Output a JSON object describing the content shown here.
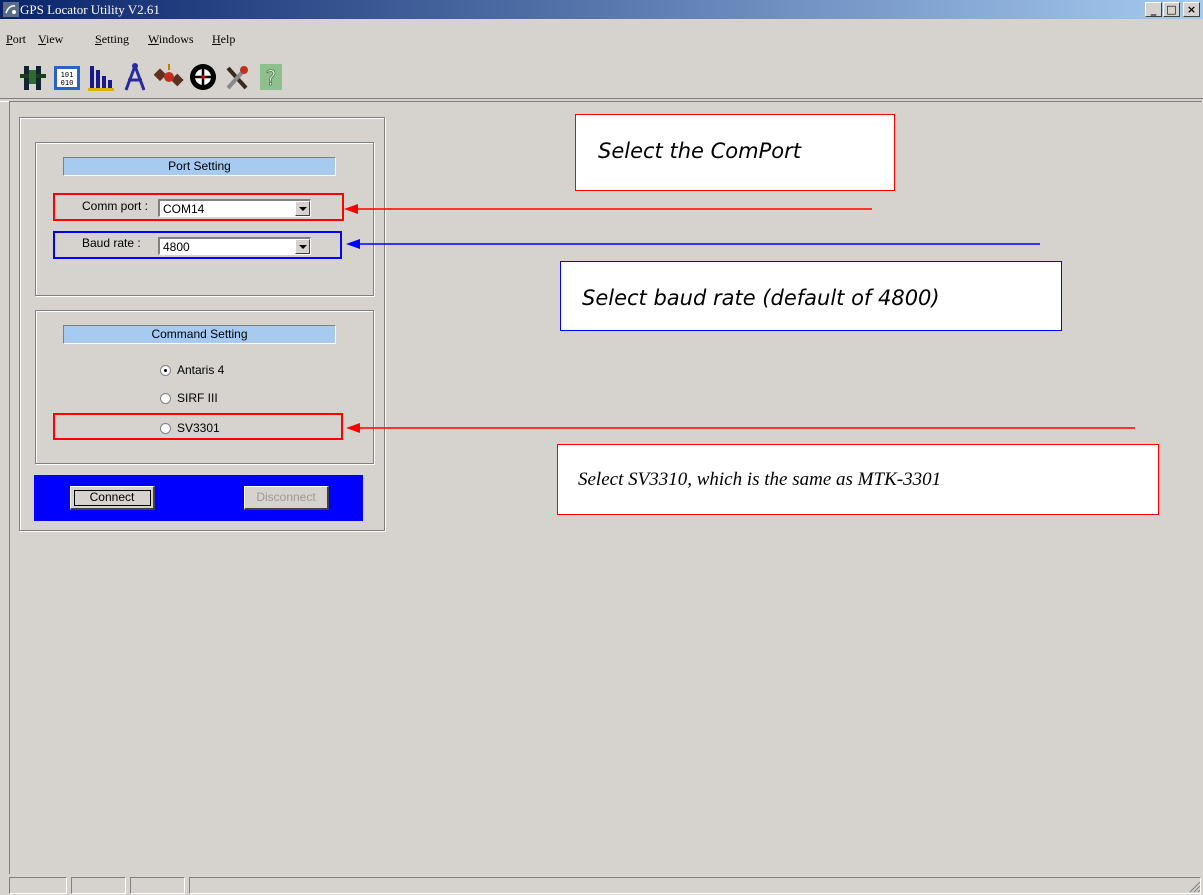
{
  "window": {
    "title": "GPS Locator Utility V2.61",
    "controls": {
      "minimize": "_",
      "maximize": "□",
      "close": "×"
    }
  },
  "menu": {
    "items": [
      {
        "label": "Port"
      },
      {
        "label": "View"
      },
      {
        "label": "Setting"
      },
      {
        "label": "Windows"
      },
      {
        "label": "Help"
      }
    ]
  },
  "toolbar": {
    "buttons": [
      {
        "icon": "connector-icon"
      },
      {
        "icon": "binary-data-icon"
      },
      {
        "icon": "signal-bars-icon"
      },
      {
        "icon": "compass-icon"
      },
      {
        "icon": "satellite-icon"
      },
      {
        "icon": "target-icon"
      },
      {
        "icon": "tools-icon"
      },
      {
        "icon": "help-icon"
      }
    ]
  },
  "port_setting": {
    "header": "Port Setting",
    "comm_port_label": "Comm port :",
    "comm_port_value": "COM14",
    "baud_rate_label": "Baud rate :",
    "baud_rate_value": "4800"
  },
  "command_setting": {
    "header": "Command Setting",
    "options": [
      {
        "label": "Antaris 4",
        "selected": true
      },
      {
        "label": "SIRF III",
        "selected": false
      },
      {
        "label": "SV3301",
        "selected": false
      }
    ]
  },
  "actions": {
    "connect": "Connect",
    "disconnect": "Disconnect"
  },
  "annotations": {
    "comport": "Select the ComPort",
    "baud": "Select baud rate (default of 4800)",
    "sv": "Select SV3310, which is the same as MTK-3301"
  },
  "colors": {
    "annotation_red": "#ff0000",
    "annotation_blue": "#0000ff",
    "header_blue": "#a6caf0",
    "button_bar": "#0000ff"
  }
}
